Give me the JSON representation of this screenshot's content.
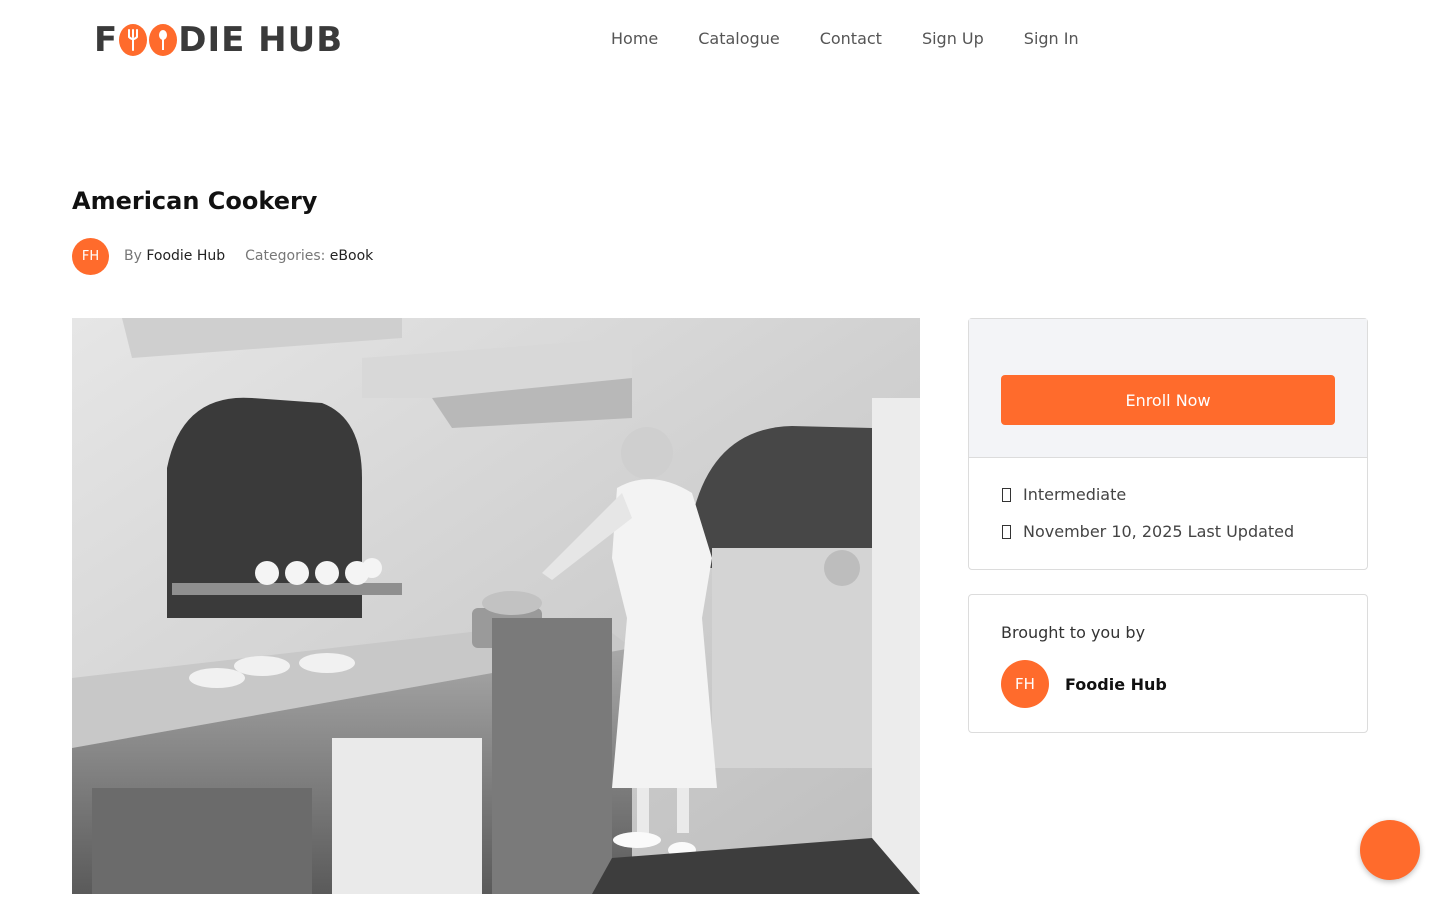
{
  "brand": {
    "logo_text_before": "F",
    "logo_text_after": "DIE HUB",
    "accent_color": "#ff6b2c"
  },
  "nav": {
    "items": [
      "Home",
      "Catalogue",
      "Contact",
      "Sign Up",
      "Sign In"
    ]
  },
  "course": {
    "title": "American Cookery",
    "author_initials": "FH",
    "by_label": "By",
    "author": "Foodie Hub",
    "categories_label": "Categories:",
    "category": "eBook",
    "image_icon": "kitchen-photo"
  },
  "sidebar": {
    "enroll_label": "Enroll Now",
    "level": "Intermediate",
    "last_updated": "November 10, 2025 Last Updated",
    "level_icon": "level-icon",
    "updated_icon": "calendar-icon"
  },
  "provider": {
    "label": "Brought to you by",
    "initials": "FH",
    "name": "Foodie Hub"
  },
  "fab": {
    "icon": "chat-icon"
  }
}
